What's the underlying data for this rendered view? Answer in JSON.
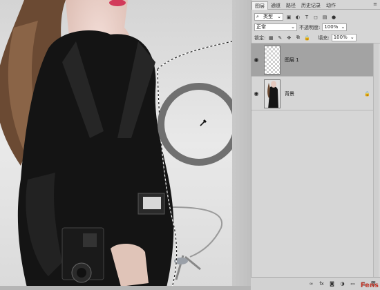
{
  "panel": {
    "tabs": [
      "图层",
      "通道",
      "路径",
      "历史记录",
      "动作"
    ],
    "active_tab": "图层",
    "menu_icon": "≡",
    "filter": {
      "label": "类型",
      "icons": [
        "image-filter-icon",
        "adjustment-filter-icon",
        "type-filter-icon",
        "shape-filter-icon",
        "smart-object-filter-icon",
        "filter-toggle-icon"
      ]
    },
    "blend_mode": "正常",
    "opacity_label": "不透明度:",
    "opacity_value": "100%",
    "lock_label": "锁定:",
    "fill_label": "填充:",
    "fill_value": "100%",
    "layers": [
      {
        "name": "图层 1",
        "selected": true,
        "visible": true,
        "thumb": "transparent"
      },
      {
        "name": "背景",
        "selected": false,
        "visible": true,
        "thumb": "photo",
        "locked": true
      }
    ],
    "bottom_icons": [
      "link-icon",
      "fx-icon",
      "mask-icon",
      "adjustment-icon",
      "group-icon",
      "new-layer-icon",
      "delete-icon"
    ],
    "fx_label": "fx"
  },
  "canvas": {
    "tool": "eyedropper",
    "brush_ring_color": "#707070",
    "selection": "marching-ants"
  },
  "watermark": "Fens"
}
